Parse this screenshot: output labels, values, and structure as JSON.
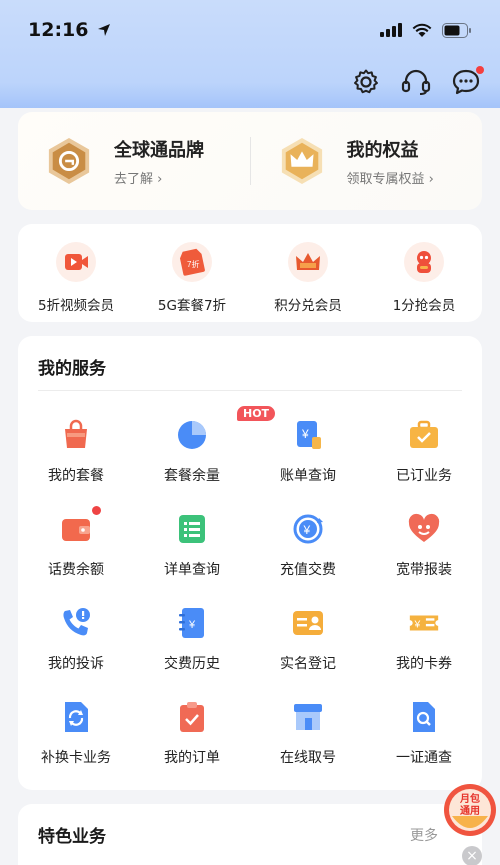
{
  "status_bar": {
    "time": "12:16"
  },
  "brand_card": {
    "left": {
      "title": "全球通品牌",
      "subtitle": "去了解 ›"
    },
    "right": {
      "title": "我的权益",
      "subtitle": "领取专属权益 ›"
    }
  },
  "promos": [
    {
      "label": "5折视频会员",
      "icon": "video-member-icon"
    },
    {
      "label": "5G套餐7折",
      "icon": "discount-tag-icon"
    },
    {
      "label": "积分兑会员",
      "icon": "crown-points-icon"
    },
    {
      "label": "1分抢会员",
      "icon": "mascot-icon"
    }
  ],
  "services": {
    "title": "我的服务",
    "hot_tag": "HOT",
    "items": [
      {
        "label": "我的套餐"
      },
      {
        "label": "套餐余量"
      },
      {
        "label": "账单查询"
      },
      {
        "label": "已订业务"
      },
      {
        "label": "话费余额"
      },
      {
        "label": "详单查询"
      },
      {
        "label": "充值交费"
      },
      {
        "label": "宽带报装"
      },
      {
        "label": "我的投诉"
      },
      {
        "label": "交费历史"
      },
      {
        "label": "实名登记"
      },
      {
        "label": "我的卡券"
      },
      {
        "label": "补换卡业务"
      },
      {
        "label": "我的订单"
      },
      {
        "label": "在线取号"
      },
      {
        "label": "一证通查"
      }
    ]
  },
  "special": {
    "title": "特色业务",
    "more": "更多"
  },
  "float_ad": {
    "line1": "月包",
    "line2": "通用"
  },
  "colors": {
    "accent_blue": "#3b82f6",
    "accent_red": "#f2555a",
    "gold": "#d9a25a"
  }
}
